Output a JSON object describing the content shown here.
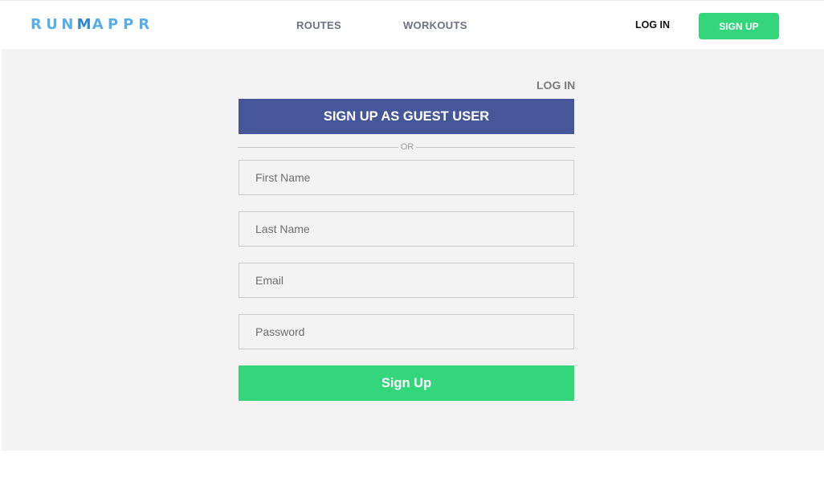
{
  "brand": {
    "letters": [
      "R",
      "U",
      "N",
      "M",
      "A",
      "P",
      "P",
      "R"
    ],
    "letter_colors": [
      "#5aaee8",
      "#5aaee8",
      "#5aaee8",
      "#2f86d6",
      "#5aaee8",
      "#5aaee8",
      "#5aaee8",
      "#5aaee8"
    ]
  },
  "nav": {
    "routes": "ROUTES",
    "workouts": "WORKOUTS"
  },
  "header": {
    "login": "LOG IN",
    "signup": "SIGN UP"
  },
  "form": {
    "login_link": "LOG IN",
    "guest_button": "SIGN UP AS GUEST USER",
    "divider": "OR",
    "first_name_placeholder": "First Name",
    "last_name_placeholder": "Last Name",
    "email_placeholder": "Email",
    "password_placeholder": "Password",
    "submit": "Sign Up"
  },
  "colors": {
    "accent_green": "#33d67a",
    "guest_blue": "#455699",
    "panel_bg": "#f3f3f3"
  }
}
